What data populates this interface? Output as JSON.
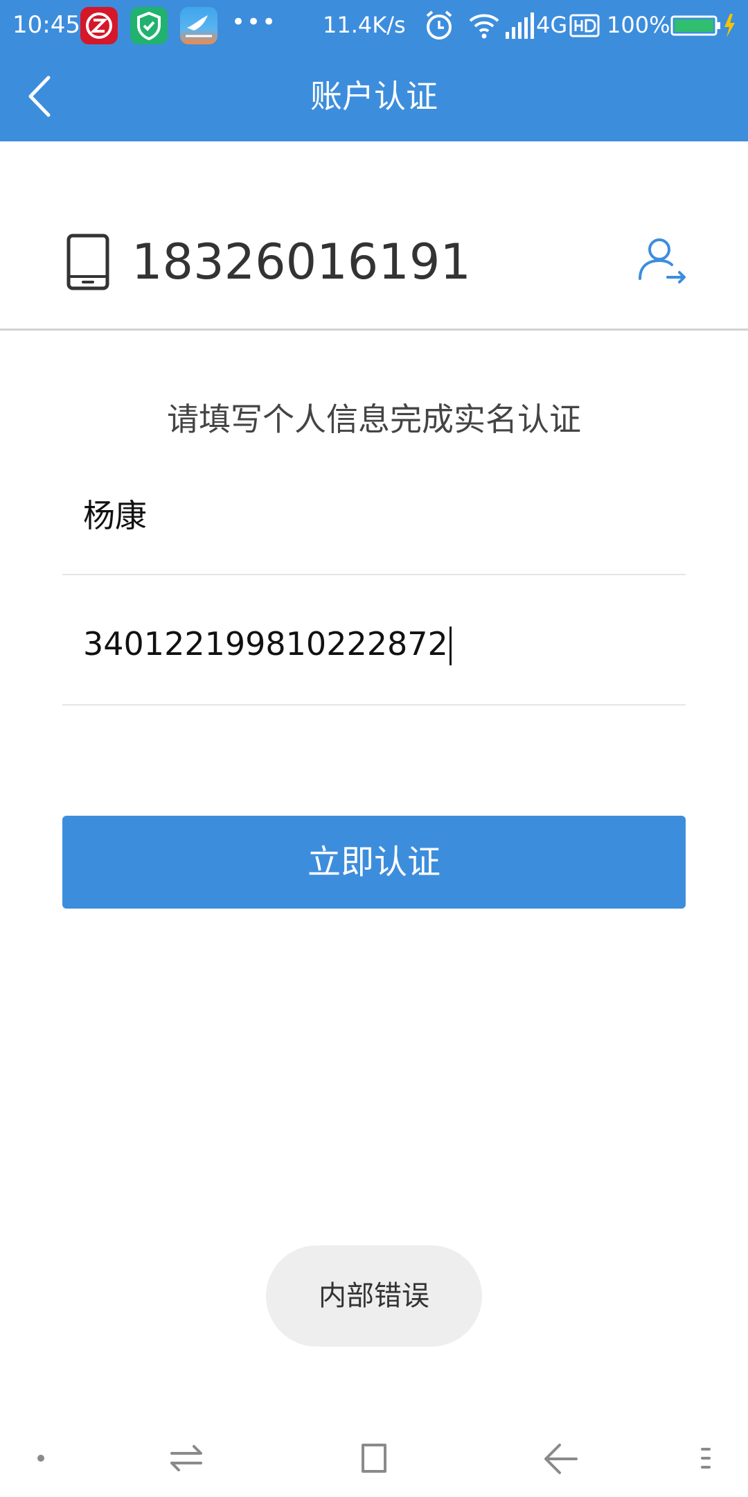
{
  "status_bar": {
    "time": "10:45",
    "more": "•••",
    "net_speed": "11.4K/s",
    "network": "4G",
    "battery": "100%",
    "apps": [
      "z-app-icon",
      "security-shield-app-icon",
      "bird-app-icon"
    ]
  },
  "app_bar": {
    "title": "账户认证"
  },
  "account": {
    "phone": "18326016191"
  },
  "form": {
    "instruction": "请填写个人信息完成实名认证",
    "name_value": "杨康",
    "id_value": "340122199810222872",
    "submit_label": "立即认证"
  },
  "toast": {
    "message": "内部错误"
  },
  "colors": {
    "primary": "#3d8ddd",
    "divider": "#e6e6e6",
    "toast_bg": "#eeeeee"
  }
}
